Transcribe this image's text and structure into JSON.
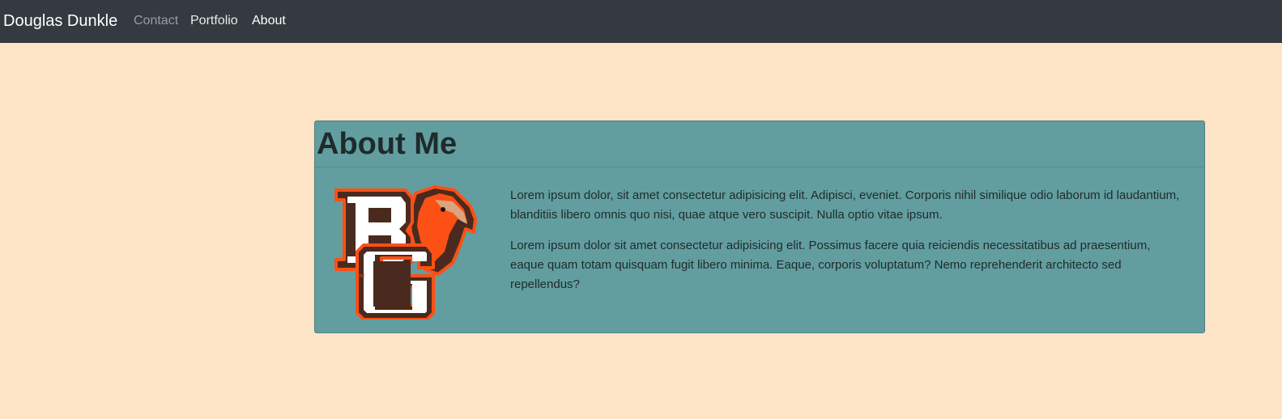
{
  "navbar": {
    "brand": "Douglas Dunkle",
    "links": [
      "Contact",
      "Portfolio",
      "About"
    ]
  },
  "about": {
    "title": "About Me",
    "paragraphs": [
      "Lorem ipsum dolor, sit amet consectetur adipisicing elit. Adipisci, eveniet. Corporis nihil similique odio laborum id laudantium, blanditiis libero omnis quo nisi, quae atque vero suscipit. Nulla optio vitae ipsum.",
      "Lorem ipsum dolor sit amet consectetur adipisicing elit. Possimus facere quia reiciendis necessitatibus ad praesentium, eaque quam totam quisquam fugit libero minima. Eaque, corporis voluptatum? Nemo reprehenderit architecto sed repellendus?"
    ],
    "logo_icon": "bg-falcon-logo-icon"
  },
  "colors": {
    "page_bg": "#fee4c6",
    "navbar_bg": "#343a40",
    "card_bg": "#629e9f",
    "logo_brown": "#4a2a1e",
    "logo_orange": "#fd5014"
  }
}
